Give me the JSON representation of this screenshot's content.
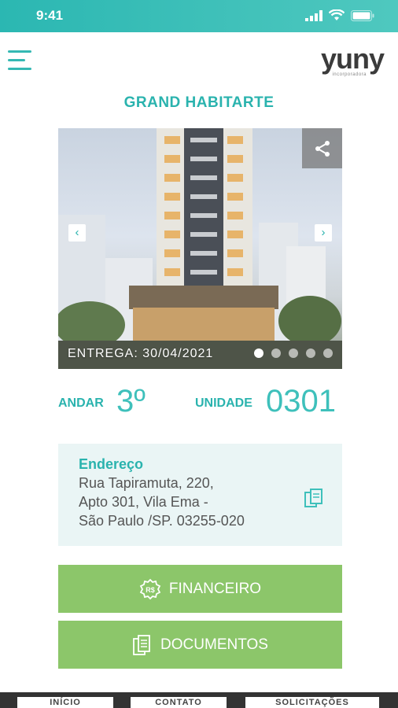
{
  "status": {
    "time": "9:41"
  },
  "brand": {
    "logo_word": "yuny",
    "logo_sub": "incorporadora"
  },
  "page": {
    "title": "GRAND HABITARTE"
  },
  "hero": {
    "delivery": "ENTREGA: 30/04/2021",
    "slide_count": 5,
    "active_slide": 1,
    "prev_glyph": "‹",
    "next_glyph": "›"
  },
  "unit": {
    "floor_label": "ANDAR",
    "floor_value": "3º",
    "unit_label": "UNIDADE",
    "unit_value": "0301"
  },
  "address": {
    "heading": "Endereço",
    "lines": [
      "Rua Tapiramuta, 220,",
      "Apto 301, Vila Ema -",
      "São Paulo /SP. 03255-020"
    ]
  },
  "actions": {
    "financeiro": "FINANCEIRO",
    "documentos": "DOCUMENTOS"
  },
  "tabbar": {
    "inicio": "INÍCIO",
    "contato": "CONTATO",
    "solicitacoes": "SOLICITAÇÕES"
  },
  "colors": {
    "accent": "#2ab3ae",
    "button": "#8cc66a",
    "address_bg": "#eaf5f5"
  }
}
